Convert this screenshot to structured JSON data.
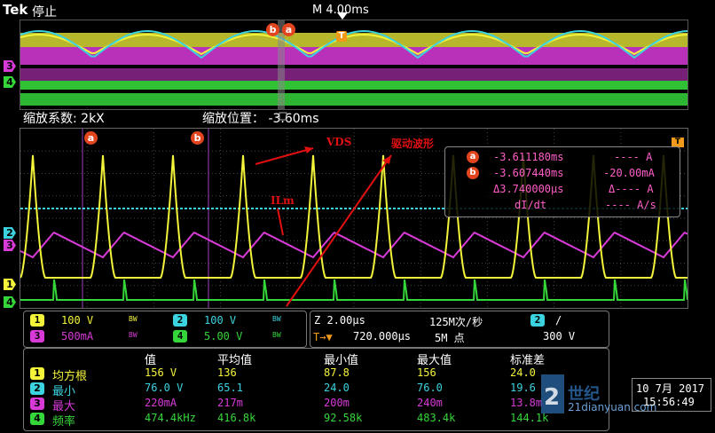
{
  "colors": {
    "ch1": "#f4f43a",
    "ch2": "#3cd3e0",
    "ch3": "#d83ad8",
    "ch4": "#35d63a",
    "marker": "#e2451e",
    "annotation": "#e01010",
    "cursor_text": "#ff5ec8"
  },
  "header": {
    "brand": "Tek",
    "state": "停止",
    "timebase": "M 4.00ms"
  },
  "overview": {
    "marker_b": "b",
    "marker_a": "a",
    "trigger_mark": "T"
  },
  "channel_tags": {
    "ch3": "3",
    "ch4": "4",
    "ch2": "2",
    "ch1": "1"
  },
  "zoom": {
    "factor_label": "缩放系数: 2kX",
    "position_label": "缩放位置： -3.60ms"
  },
  "grid": {
    "marker_a": "a",
    "marker_b": "b",
    "trigger_icon": "T"
  },
  "annotations": {
    "vds": "VDS",
    "drive": "驱动波形",
    "ilm": "ILm"
  },
  "cursor_readout": {
    "a_time": "-3.611180ms",
    "a_value": "---- A",
    "b_time": "-3.607440ms",
    "b_value": "-20.00mA",
    "delta_time": "Δ3.740000µs",
    "delta_value": "Δ---- A",
    "didt_label": "dI/dt",
    "didt_value": "---- A/s"
  },
  "vertical": [
    {
      "ch": "1",
      "scale": "100 V",
      "bw": "BW"
    },
    {
      "ch": "2",
      "scale": "100 V",
      "bw": "BW"
    },
    {
      "ch": "3",
      "scale": "500mA",
      "bw": "BW"
    },
    {
      "ch": "4",
      "scale": "5.00 V",
      "bw": "BW"
    }
  ],
  "horizontal": {
    "zoom_scale": "Z 2.00µs",
    "sample_rate": "125M次/秒",
    "delay": "720.000µs",
    "record": "5M 点",
    "trig_ch": "2",
    "trig_slope": "/",
    "trig_level": "300 V",
    "delay_icon": "T→▼"
  },
  "measurements": {
    "headers": [
      "值",
      "平均值",
      "最小值",
      "最大值",
      "标准差"
    ],
    "rows": [
      {
        "ch": "1",
        "name": "均方根",
        "values": [
          "156 V",
          "136",
          "87.8",
          "156",
          "24.0"
        ]
      },
      {
        "ch": "2",
        "name": "最小",
        "values": [
          "76.0 V",
          "65.1",
          "24.0",
          "76.0",
          "19.6"
        ]
      },
      {
        "ch": "3",
        "name": "最大",
        "values": [
          "220mA",
          "217m",
          "200m",
          "240m",
          "13.8m"
        ]
      },
      {
        "ch": "4",
        "name": "频率",
        "values": [
          "474.4kHz",
          "416.8k",
          "92.58k",
          "483.4k",
          "144.1k"
        ]
      }
    ]
  },
  "datetime": {
    "date": "10 7月 2017",
    "time": "15:56:49"
  },
  "watermark": {
    "site": "21dianyuan.com",
    "logo_text": "世纪电源网"
  }
}
